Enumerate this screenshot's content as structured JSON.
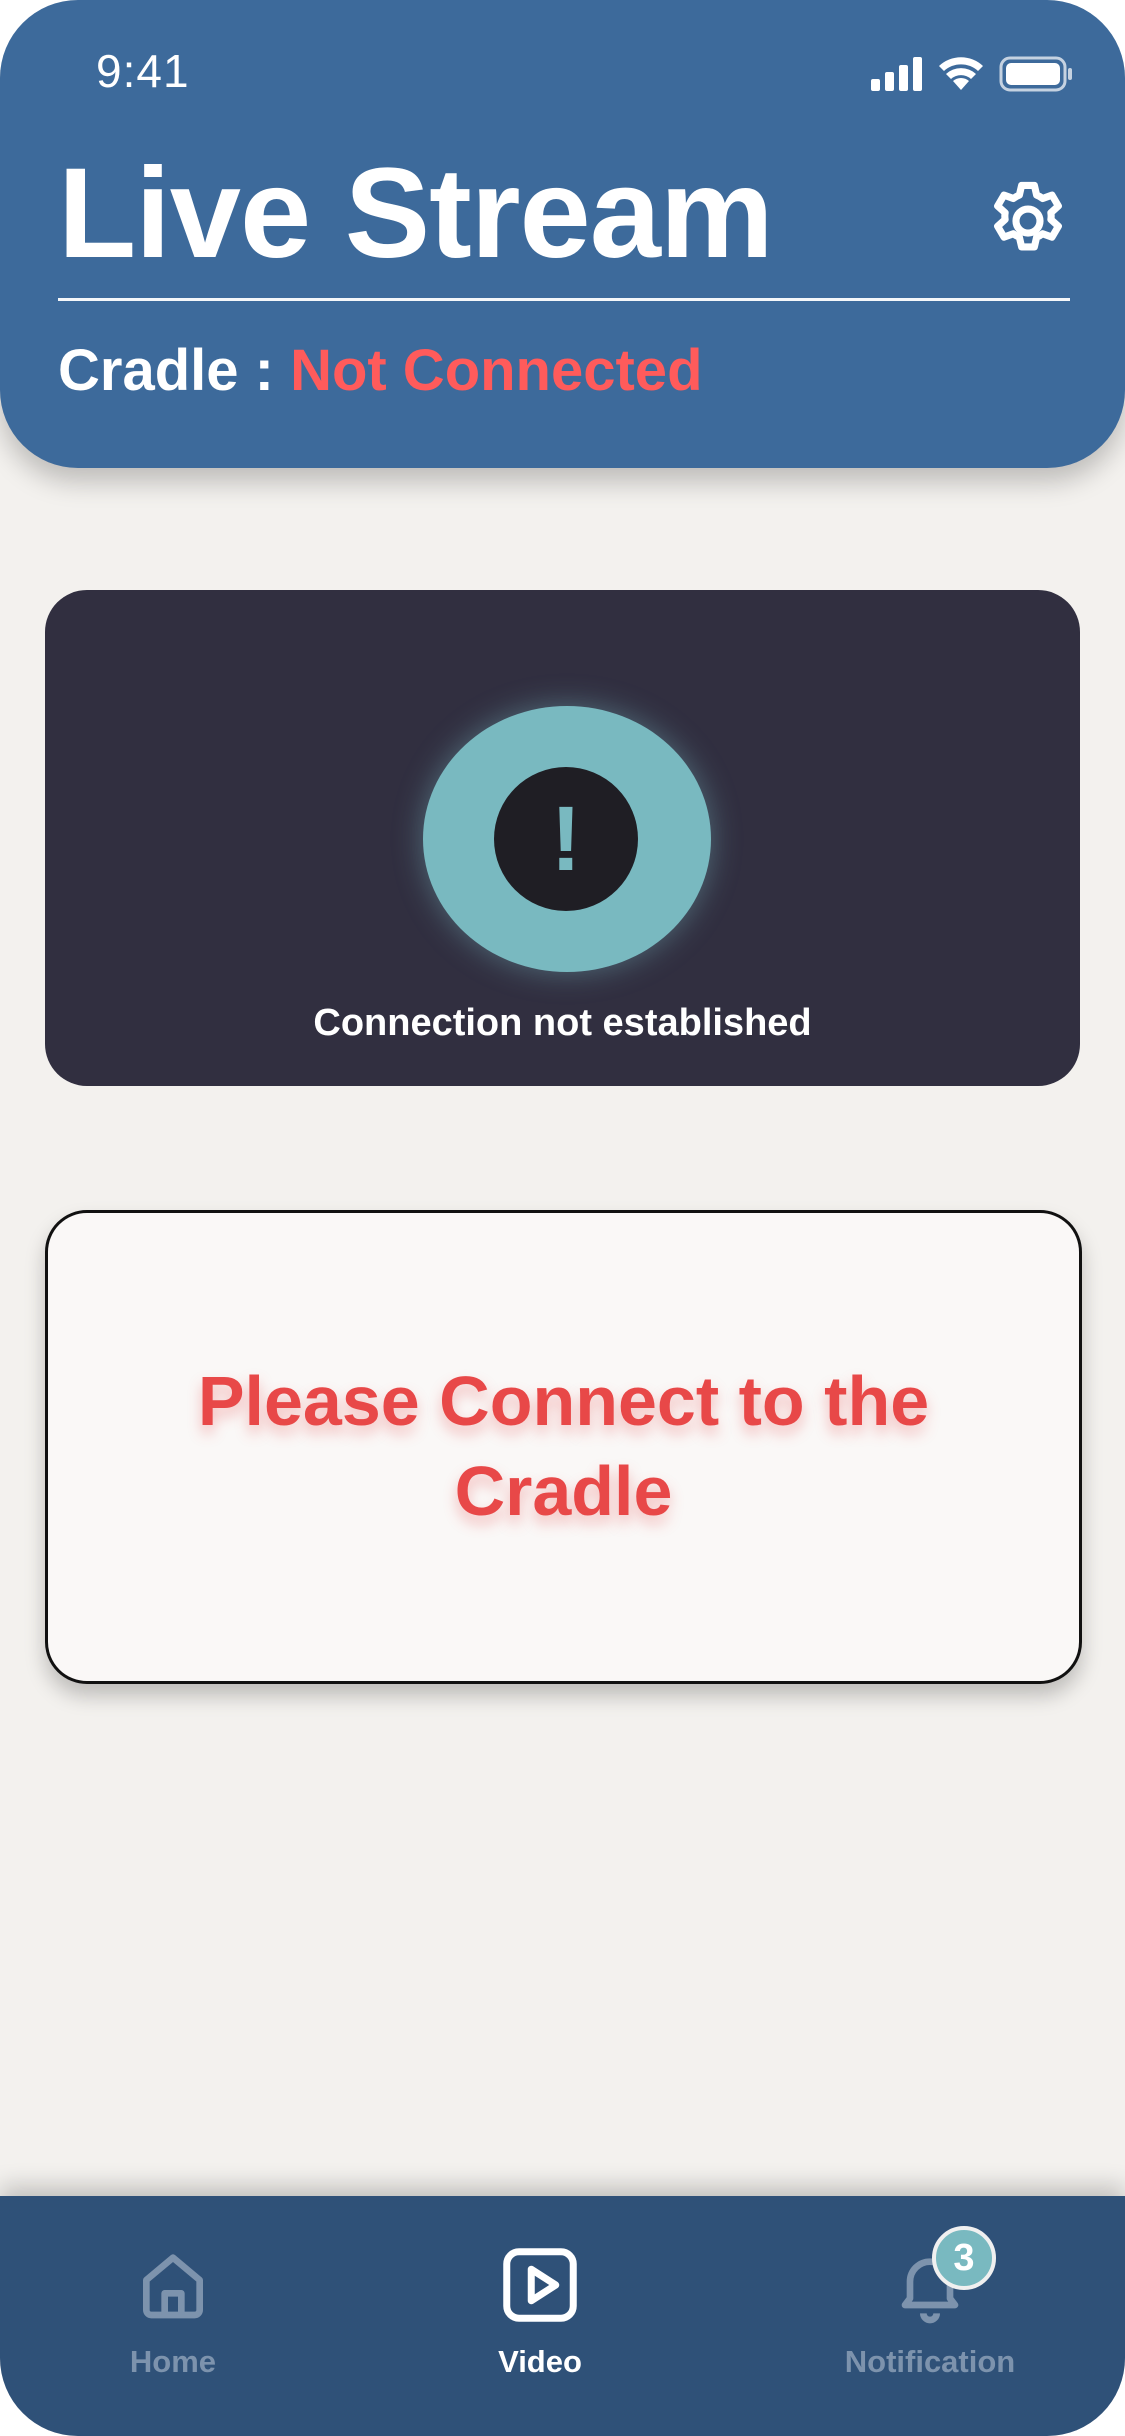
{
  "status_bar": {
    "time": "9:41"
  },
  "header": {
    "title": "Live Stream",
    "cradle_label": "Cradle : ",
    "cradle_status": "Not Connected"
  },
  "connection_card": {
    "icon_glyph": "!",
    "message": "Connection not established"
  },
  "prompt_box": {
    "message": "Please Connect to the Cradle"
  },
  "tab_bar": {
    "tabs": [
      {
        "label": "Home",
        "icon": "home-icon",
        "active": false
      },
      {
        "label": "Video",
        "icon": "play-icon",
        "active": true
      },
      {
        "label": "Notification",
        "icon": "bell-icon",
        "active": false,
        "badge": "3"
      }
    ]
  },
  "colors": {
    "header_bg": "#3d6a9b",
    "status_red": "#ff5b5b",
    "card_dark": "#312f40",
    "accent_teal": "#79b9c0",
    "tabbar_bg": "#2f5178"
  }
}
